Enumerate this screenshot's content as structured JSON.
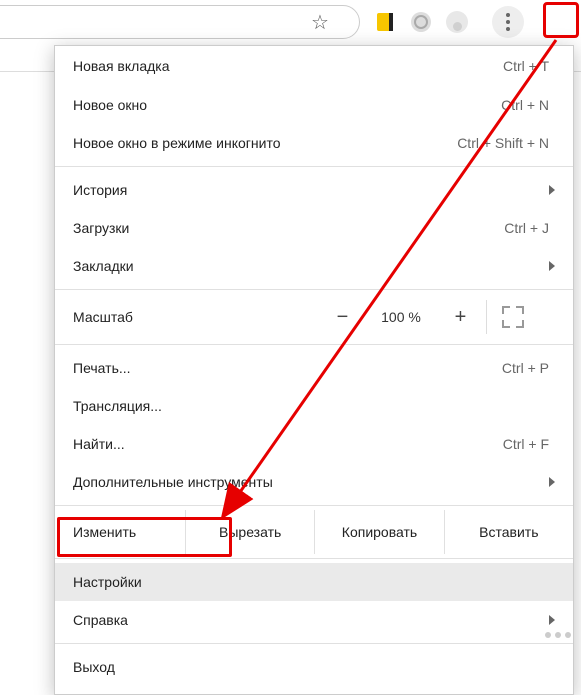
{
  "toolbar": {
    "menu_button": "menu"
  },
  "menu": {
    "new_tab": {
      "label": "Новая вкладка",
      "shortcut": "Ctrl + T"
    },
    "new_window": {
      "label": "Новое окно",
      "shortcut": "Ctrl + N"
    },
    "incognito": {
      "label": "Новое окно в режиме инкогнито",
      "shortcut": "Ctrl + Shift + N"
    },
    "history": {
      "label": "История"
    },
    "downloads": {
      "label": "Загрузки",
      "shortcut": "Ctrl + J"
    },
    "bookmarks": {
      "label": "Закладки"
    },
    "zoom": {
      "label": "Масштаб",
      "value": "100 %",
      "minus": "−",
      "plus": "+"
    },
    "print": {
      "label": "Печать...",
      "shortcut": "Ctrl + P"
    },
    "cast": {
      "label": "Трансляция..."
    },
    "find": {
      "label": "Найти...",
      "shortcut": "Ctrl + F"
    },
    "more_tools": {
      "label": "Дополнительные инструменты"
    },
    "edit": {
      "label": "Изменить",
      "cut": "Вырезать",
      "copy": "Копировать",
      "paste": "Вставить"
    },
    "settings": {
      "label": "Настройки"
    },
    "help": {
      "label": "Справка"
    },
    "exit": {
      "label": "Выход"
    }
  }
}
